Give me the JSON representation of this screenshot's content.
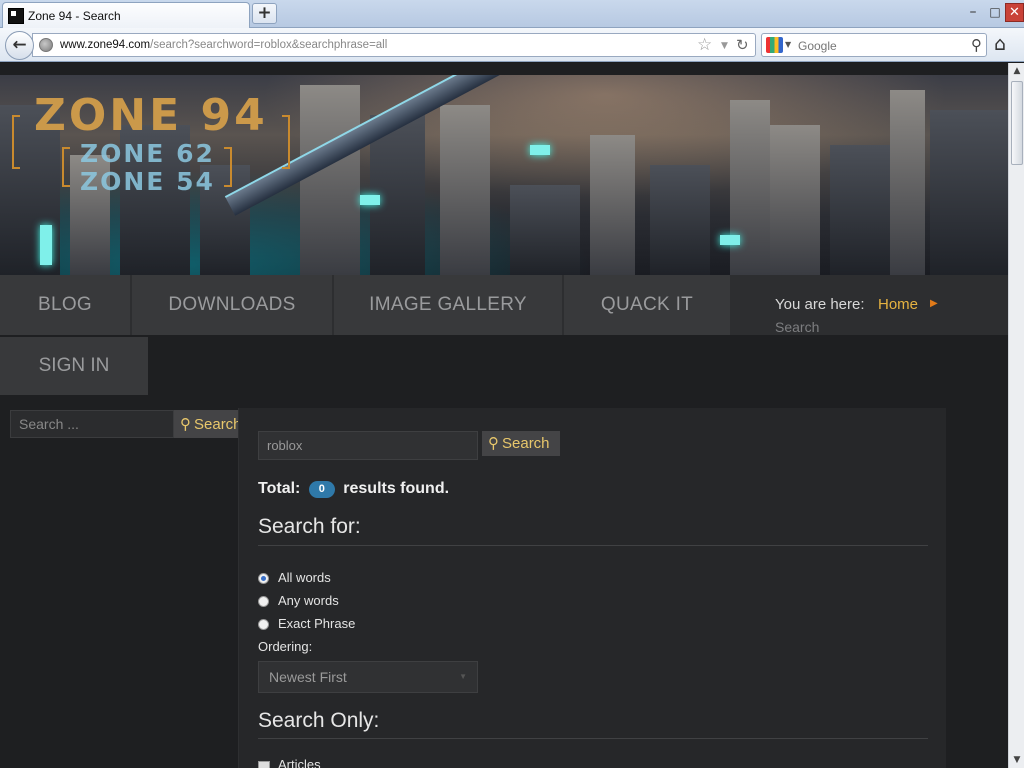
{
  "browser": {
    "tab_title": "Zone 94 - Search",
    "url_domain": "www.zone94.com",
    "url_path": "/search?searchword=roblox&searchphrase=all",
    "search_placeholder": "Google",
    "window_controls": {
      "minimize": "–",
      "maximize": "□",
      "close": "✕"
    }
  },
  "banner": {
    "logo_main": "ZONE 94",
    "logo_sub1": "ZONE 62",
    "logo_sub2": "ZONE 54"
  },
  "menu": {
    "items": [
      "BLOG",
      "DOWNLOADS",
      "IMAGE GALLERY",
      "QUACK IT"
    ],
    "sign_in": "SIGN IN"
  },
  "breadcrumb": {
    "label": "You are here:",
    "home": "Home",
    "current": "Search"
  },
  "sidebar_search": {
    "placeholder": "Search ...",
    "button": "Search"
  },
  "search": {
    "query": "roblox",
    "button": "Search",
    "total_label": "Total:",
    "total_count": "0",
    "results_label": "results found.",
    "search_for_heading": "Search for:",
    "options": [
      "All words",
      "Any words",
      "Exact Phrase"
    ],
    "selected_option": "All words",
    "ordering_label": "Ordering:",
    "ordering_value": "Newest First",
    "search_only_heading": "Search Only:",
    "search_only_items": [
      "Articles"
    ]
  },
  "colors": {
    "accent_gold": "#e8c76b",
    "breadcrumb_home": "#e6b341",
    "badge_blue": "#2f79a9"
  }
}
